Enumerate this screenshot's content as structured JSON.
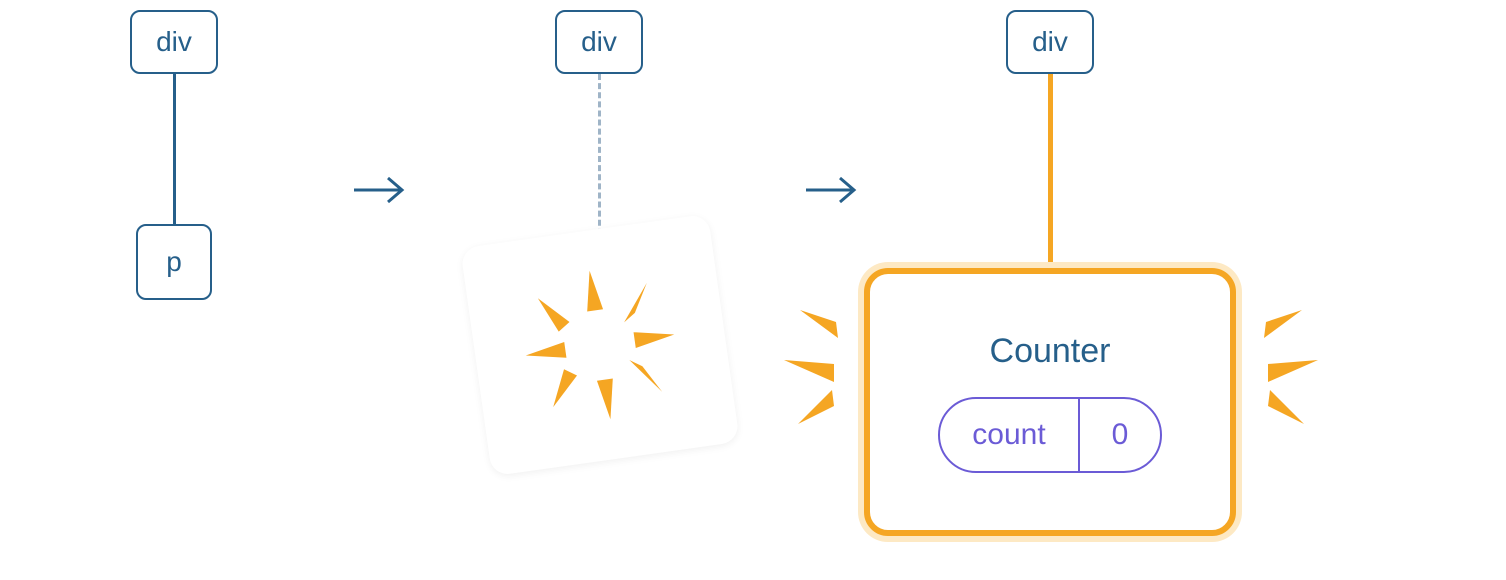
{
  "colors": {
    "node_border": "#265f8a",
    "node_text": "#265f8a",
    "highlight": "#f5a623",
    "highlight_glow": "#fde9c4",
    "state_border": "#6b5bd6",
    "arrow": "#265f8a",
    "dashed_connector": "#9fb4c7"
  },
  "stage1": {
    "parent_label": "div",
    "child_label": "p"
  },
  "stage2": {
    "parent_label": "div"
  },
  "stage3": {
    "parent_label": "div",
    "component_title": "Counter",
    "state_key": "count",
    "state_value": "0"
  }
}
